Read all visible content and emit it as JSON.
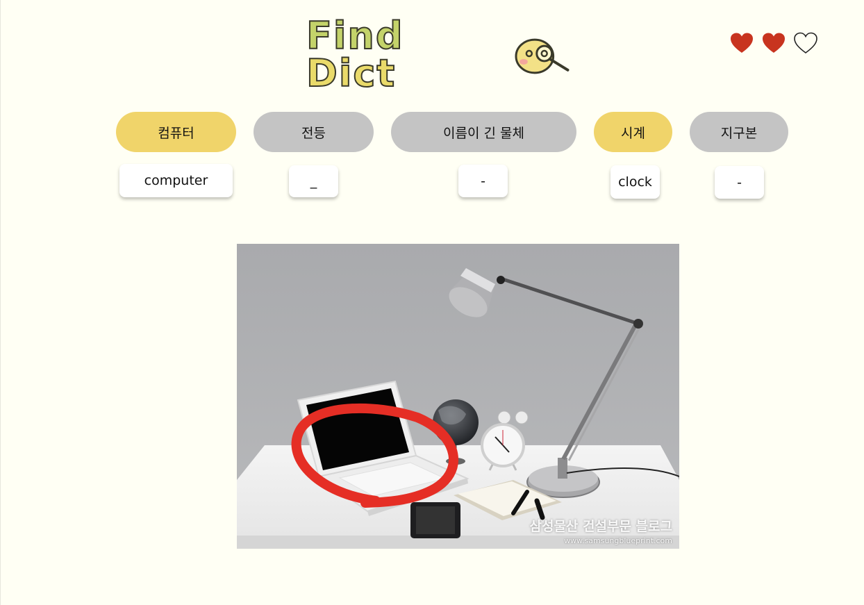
{
  "header": {
    "logo": {
      "part1": "Find",
      "part2": "Dict",
      "icon": "magnifier-face-icon"
    },
    "lives": {
      "total": 3,
      "filled": 2,
      "icon": "heart-icon"
    }
  },
  "categories": [
    {
      "label": "컴퓨터",
      "found": true,
      "answer": "computer"
    },
    {
      "label": "전등",
      "found": false,
      "answer": "_"
    },
    {
      "label": "이름이 긴 물체",
      "found": false,
      "answer": "-"
    },
    {
      "label": "시계",
      "found": true,
      "answer": "clock"
    },
    {
      "label": "지구본",
      "found": false,
      "answer": "-"
    }
  ],
  "photo": {
    "watermark_title": "삼성물산 건설부문 블로그",
    "watermark_url": "www.samsungblueprint.com"
  },
  "colors": {
    "found_chip": "#f0d46a",
    "unfound_chip": "#c4c4c4",
    "heart": "#c8341f",
    "background": "#fffff4",
    "highlight_circle": "#e52e25"
  }
}
